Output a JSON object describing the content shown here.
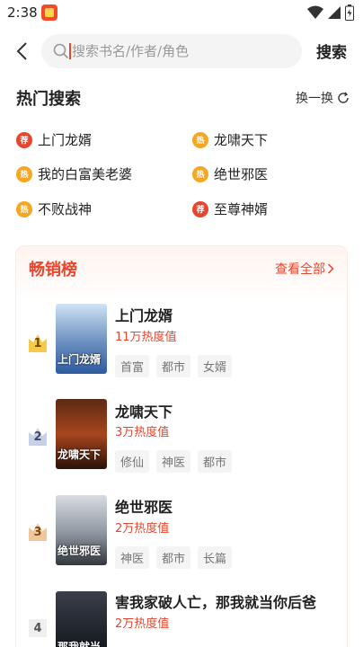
{
  "status_bar": {
    "time": "2:38",
    "icons": [
      "app-notification-icon",
      "wifi-icon",
      "signal-icon",
      "battery-icon"
    ]
  },
  "search": {
    "placeholder": "搜索书名/作者/角色",
    "button_label": "搜索"
  },
  "hot_search": {
    "title": "热门搜索",
    "refresh_label": "换一换",
    "items": [
      {
        "label": "上门龙婿",
        "badge": "荐"
      },
      {
        "label": "龙啸天下",
        "badge": "热"
      },
      {
        "label": "我的白富美老婆",
        "badge": "热"
      },
      {
        "label": "绝世邪医",
        "badge": "热"
      },
      {
        "label": "不败战神",
        "badge": "热"
      },
      {
        "label": "至尊神婿",
        "badge": "荐"
      }
    ]
  },
  "bestseller": {
    "title": "畅销榜",
    "see_all_label": "查看全部",
    "books": [
      {
        "rank": "1",
        "title": "上门龙婿",
        "heat": "11万热度值",
        "tags": [
          "首富",
          "都市",
          "女婿"
        ],
        "cover_text": "上门龙婿"
      },
      {
        "rank": "2",
        "title": "龙啸天下",
        "heat": "3万热度值",
        "tags": [
          "修仙",
          "神医",
          "都市"
        ],
        "cover_text": "龙啸天下"
      },
      {
        "rank": "3",
        "title": "绝世邪医",
        "heat": "2万热度值",
        "tags": [
          "神医",
          "都市",
          "长篇"
        ],
        "cover_text": "绝世邪医"
      },
      {
        "rank": "4",
        "title": "害我家破人亡，那我就当你后爸",
        "heat": "2万热度值",
        "tags": [],
        "cover_text": "那我就当"
      }
    ]
  },
  "colors": {
    "accent": "#e8452e",
    "hot_badge": "#f5a623"
  }
}
